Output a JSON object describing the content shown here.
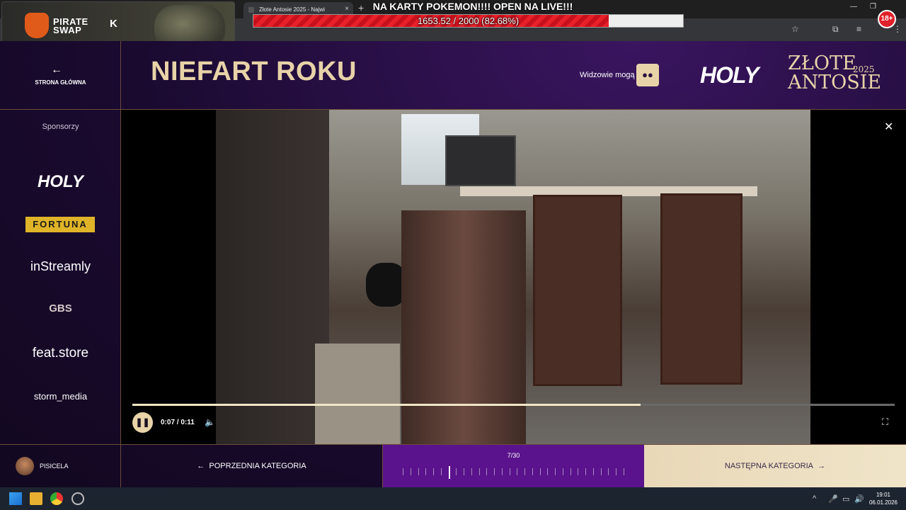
{
  "browser": {
    "tab_title": "Złote Antosie 2025 - Najwi",
    "new_tab": "+",
    "minimize": "—",
    "maximize": "❐",
    "close": "✕",
    "star_icon": "star-icon",
    "extensions_icon": "puzzle-icon"
  },
  "overlay": {
    "brand_line1": "PIRATE",
    "brand_line2": "SWAP",
    "k_logo": "K",
    "goal_title": "NA KARTY POKEMON!!!! OPEN NA LIVE!!!",
    "goal_text": "1653.52 / 2000 (82.68%)",
    "goal_fraction": 0.8268,
    "age_badge": "18+"
  },
  "header": {
    "back_label": "STRONA GŁÓWNA",
    "page_title": "NIEFART ROKU",
    "viewers_label": "Widzowie mogą",
    "holy_logo": "HOLY",
    "event_logo_line1": "ZŁOTE",
    "event_logo_line2": "ANTOSIE",
    "event_year": "2025"
  },
  "sidebar": {
    "title": "Sponsorzy",
    "sponsors": [
      "HOLY",
      "FORTUNA",
      "inStreamly",
      "GBS",
      "feat.store",
      "storm_media"
    ]
  },
  "video": {
    "time_label": "0:07 / 0:11",
    "progress_fraction": 0.667
  },
  "bottom": {
    "username": "PISICELA",
    "prev_label": "POPRZEDNIA KATEGORIA",
    "counter": "7/30",
    "current_index": 7,
    "total": 30,
    "next_label": "NASTĘPNA KATEGORIA"
  },
  "taskbar": {
    "time": "19:01",
    "date": "06.01.2026"
  },
  "colors": {
    "accent_gold": "#e8d3a8",
    "purple": "#5a138c",
    "goal_red": "#e8202a"
  }
}
